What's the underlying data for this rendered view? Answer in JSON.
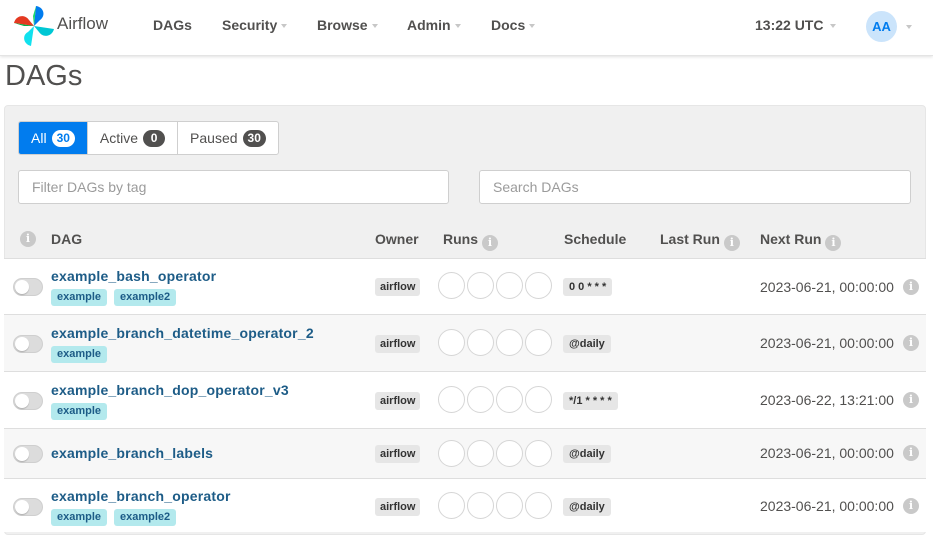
{
  "navbar": {
    "brand": "Airflow",
    "items": [
      "DAGs",
      "Security",
      "Browse",
      "Admin",
      "Docs"
    ],
    "time": "13:22 UTC",
    "user_initials": "AA"
  },
  "page_title": "DAGs",
  "filters": {
    "all_label": "All",
    "all_count": "30",
    "active_label": "Active",
    "active_count": "0",
    "paused_label": "Paused",
    "paused_count": "30"
  },
  "tag_filter": {
    "placeholder": "Filter DAGs by tag"
  },
  "search": {
    "placeholder": "Search DAGs"
  },
  "columns": {
    "dag": "DAG",
    "owner": "Owner",
    "runs": "Runs",
    "schedule": "Schedule",
    "last_run": "Last Run",
    "next_run": "Next Run"
  },
  "info_glyph": "i",
  "dags": [
    {
      "name": "example_bash_operator",
      "tags": [
        "example",
        "example2"
      ],
      "owner": "airflow",
      "schedule": "0 0 * * *",
      "next_run": "2023-06-21, 00:00:00"
    },
    {
      "name": "example_branch_datetime_operator_2",
      "tags": [
        "example"
      ],
      "owner": "airflow",
      "schedule": "@daily",
      "next_run": "2023-06-21, 00:00:00"
    },
    {
      "name": "example_branch_dop_operator_v3",
      "tags": [
        "example"
      ],
      "owner": "airflow",
      "schedule": "*/1 * * * *",
      "next_run": "2023-06-22, 13:21:00"
    },
    {
      "name": "example_branch_labels",
      "tags": [],
      "owner": "airflow",
      "schedule": "@daily",
      "next_run": "2023-06-21, 00:00:00"
    },
    {
      "name": "example_branch_operator",
      "tags": [
        "example",
        "example2"
      ],
      "owner": "airflow",
      "schedule": "@daily",
      "next_run": "2023-06-21, 00:00:00"
    }
  ],
  "colors": {
    "accent": "#017cee",
    "link": "#1d5c87",
    "tag_bg": "#b3e9ed"
  }
}
